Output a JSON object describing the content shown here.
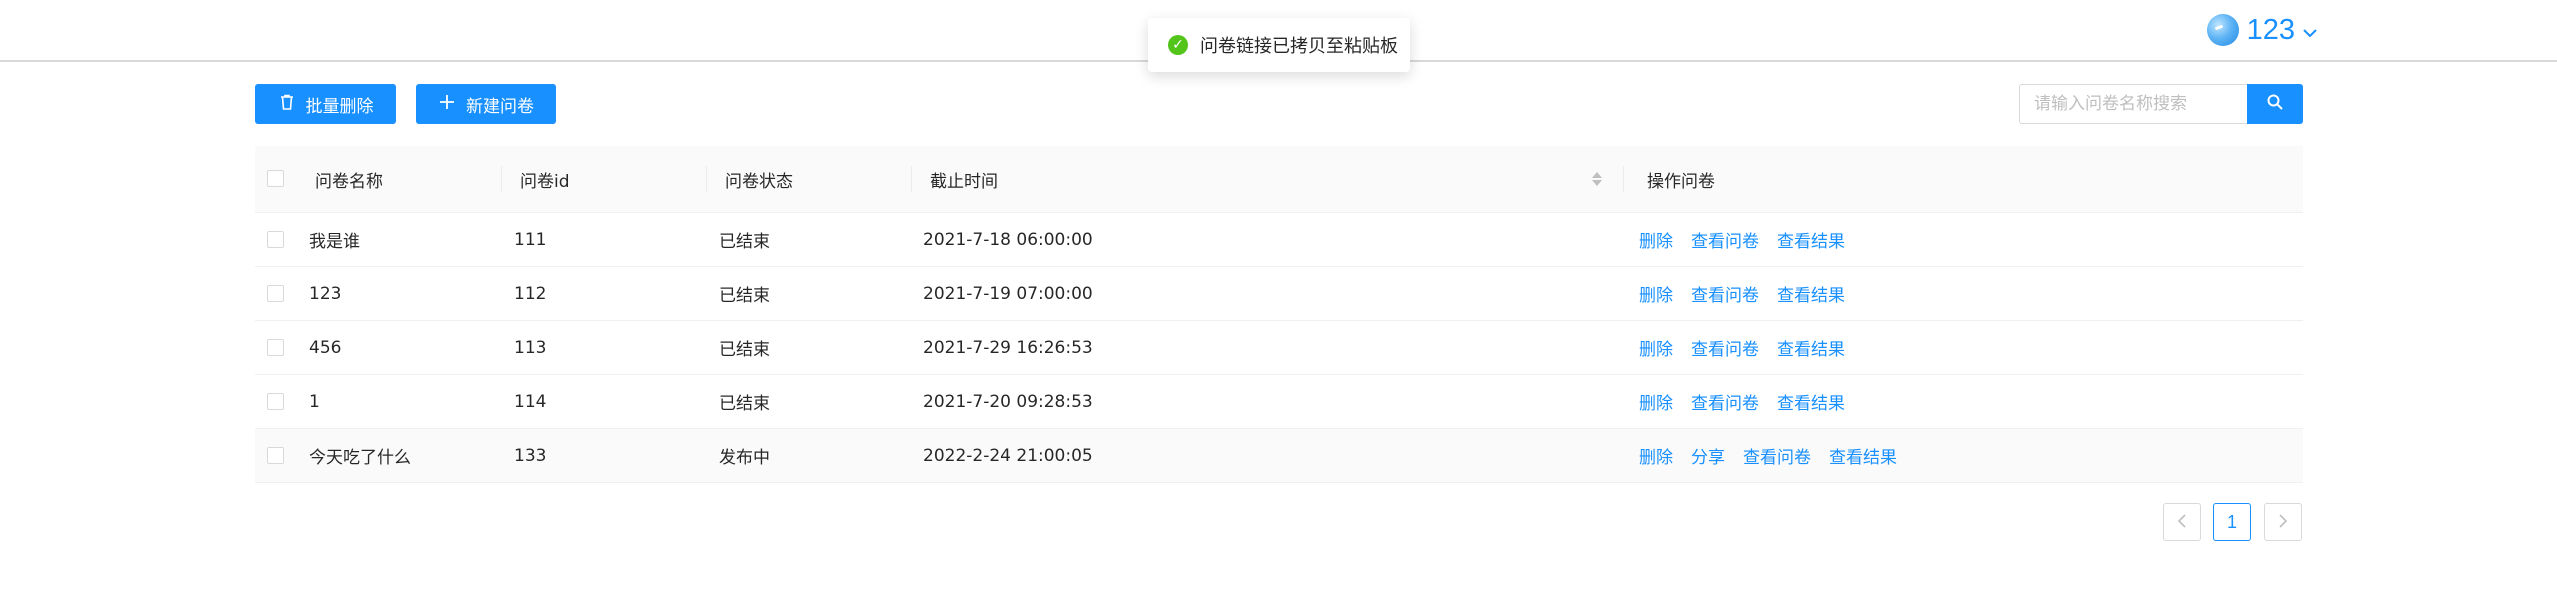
{
  "header": {
    "user_name": "123",
    "chevron": "chevron-down-icon"
  },
  "toast": {
    "icon": "check-circle-icon",
    "message": "问卷链接已拷贝至粘贴板",
    "color": "#52c41a"
  },
  "toolbar": {
    "batch_delete_label": "批量删除",
    "new_survey_label": "新建问卷",
    "search_placeholder": "请输入问卷名称搜索",
    "search_value": ""
  },
  "table": {
    "columns": [
      "问卷名称",
      "问卷id",
      "问卷状态",
      "截止时间",
      "操作问卷"
    ],
    "rows": [
      {
        "name": "我是谁",
        "id": "111",
        "status": "已结束",
        "deadline": "2021-7-18 06:00:00",
        "actions": [
          "删除",
          "查看问卷",
          "查看结果"
        ]
      },
      {
        "name": "123",
        "id": "112",
        "status": "已结束",
        "deadline": "2021-7-19 07:00:00",
        "actions": [
          "删除",
          "查看问卷",
          "查看结果"
        ]
      },
      {
        "name": "456",
        "id": "113",
        "status": "已结束",
        "deadline": "2021-7-29 16:26:53",
        "actions": [
          "删除",
          "查看问卷",
          "查看结果"
        ]
      },
      {
        "name": "1",
        "id": "114",
        "status": "已结束",
        "deadline": "2021-7-20 09:28:53",
        "actions": [
          "删除",
          "查看问卷",
          "查看结果"
        ]
      },
      {
        "name": "今天吃了什么",
        "id": "133",
        "status": "发布中",
        "deadline": "2022-2-24 21:00:05",
        "actions": [
          "删除",
          "分享",
          "查看问卷",
          "查看结果"
        ]
      }
    ]
  },
  "pagination": {
    "current_page": "1",
    "prev_icon": "chevron-left-icon",
    "next_icon": "chevron-right-icon"
  },
  "colors": {
    "primary": "#1890ff",
    "success": "#52c41a"
  }
}
